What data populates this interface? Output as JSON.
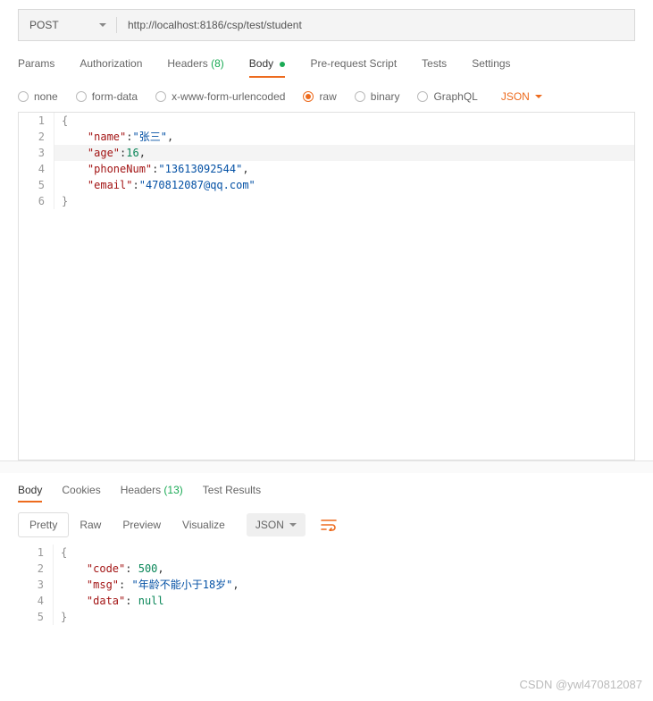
{
  "request": {
    "method": "POST",
    "url_value": "http://localhost:8186/csp/test/student"
  },
  "tabs": {
    "params": "Params",
    "auth": "Authorization",
    "headers_label": "Headers",
    "headers_count": "(8)",
    "body": "Body",
    "prerequest": "Pre-request Script",
    "tests": "Tests",
    "settings": "Settings"
  },
  "body_options": {
    "none": "none",
    "formdata": "form-data",
    "xwww": "x-www-form-urlencoded",
    "raw": "raw",
    "binary": "binary",
    "graphql": "GraphQL",
    "format": "JSON"
  },
  "request_body_lines": [
    {
      "n": "1",
      "html": "<span class='tok-brace'>{</span>"
    },
    {
      "n": "2",
      "html": "    <span class='tok-key'>\"name\"</span><span class='tok-punc'>:</span><span class='tok-string'>\"张三\"</span><span class='tok-punc'>,</span>"
    },
    {
      "n": "3",
      "html": "    <span class='tok-key'>\"age\"</span><span class='tok-punc'>:</span><span class='tok-number'>16</span><span class='tok-punc'>,</span>",
      "hl": true
    },
    {
      "n": "4",
      "html": "    <span class='tok-key'>\"phoneNum\"</span><span class='tok-punc'>:</span><span class='tok-string'>\"13613092544\"</span><span class='tok-punc'>,</span>"
    },
    {
      "n": "5",
      "html": "    <span class='tok-key'>\"email\"</span><span class='tok-punc'>:</span><span class='tok-string'>\"470812087@qq.com\"</span>"
    },
    {
      "n": "6",
      "html": "<span class='tok-brace'>}</span>"
    }
  ],
  "result_tabs": {
    "body": "Body",
    "cookies": "Cookies",
    "headers_label": "Headers",
    "headers_count": "(13)",
    "tests": "Test Results"
  },
  "view_bar": {
    "pretty": "Pretty",
    "raw": "Raw",
    "preview": "Preview",
    "visualize": "Visualize",
    "format": "JSON"
  },
  "response_body_lines": [
    {
      "n": "1",
      "html": "<span class='tok-brace'>{</span>"
    },
    {
      "n": "2",
      "html": "    <span class='tok-key'>\"code\"</span><span class='tok-punc'>:</span> <span class='tok-number'>500</span><span class='tok-punc'>,</span>"
    },
    {
      "n": "3",
      "html": "    <span class='tok-key'>\"msg\"</span><span class='tok-punc'>:</span> <span class='tok-string'>\"年龄不能小于18岁\"</span><span class='tok-punc'>,</span>"
    },
    {
      "n": "4",
      "html": "    <span class='tok-key'>\"data\"</span><span class='tok-punc'>:</span> <span class='tok-null'>null</span>"
    },
    {
      "n": "5",
      "html": "<span class='tok-brace'>}</span>"
    }
  ],
  "watermark": "CSDN @ywl470812087"
}
